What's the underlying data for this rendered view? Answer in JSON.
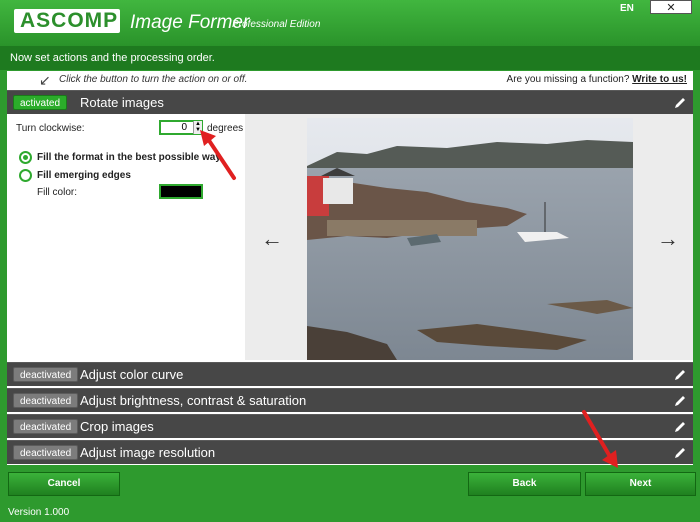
{
  "window": {
    "logo": "ASCOMP",
    "title": "Image Former",
    "edition": "Professional Edition",
    "language": "EN"
  },
  "subheader": "Now set actions and the processing order.",
  "hints": {
    "left": "Click the button to turn the action on or off.",
    "right_prefix": "Are you missing a function?",
    "right_link": "Write to us!"
  },
  "actions": [
    {
      "status": "activated",
      "label": "Rotate images"
    },
    {
      "status": "deactivated",
      "label": "Adjust color curve"
    },
    {
      "status": "deactivated",
      "label": "Adjust brightness, contrast & saturation"
    },
    {
      "status": "deactivated",
      "label": "Crop images"
    },
    {
      "status": "deactivated",
      "label": "Adjust image resolution"
    }
  ],
  "rotate_panel": {
    "turn_label": "Turn clockwise:",
    "turn_value": "0",
    "unit": "degrees",
    "option_fill_format": "Fill the format in the best possible way",
    "option_fill_edges": "Fill emerging edges",
    "fill_color_label": "Fill color:",
    "fill_color": "#000000"
  },
  "preview": {
    "prev_arrow": "←",
    "next_arrow": "→"
  },
  "buttons": {
    "cancel": "Cancel",
    "back": "Back",
    "next": "Next"
  },
  "version": "Version 1.000",
  "colors": {
    "accent": "#2e9a2e",
    "dark_row": "#474747",
    "annotation": "#e02020"
  }
}
